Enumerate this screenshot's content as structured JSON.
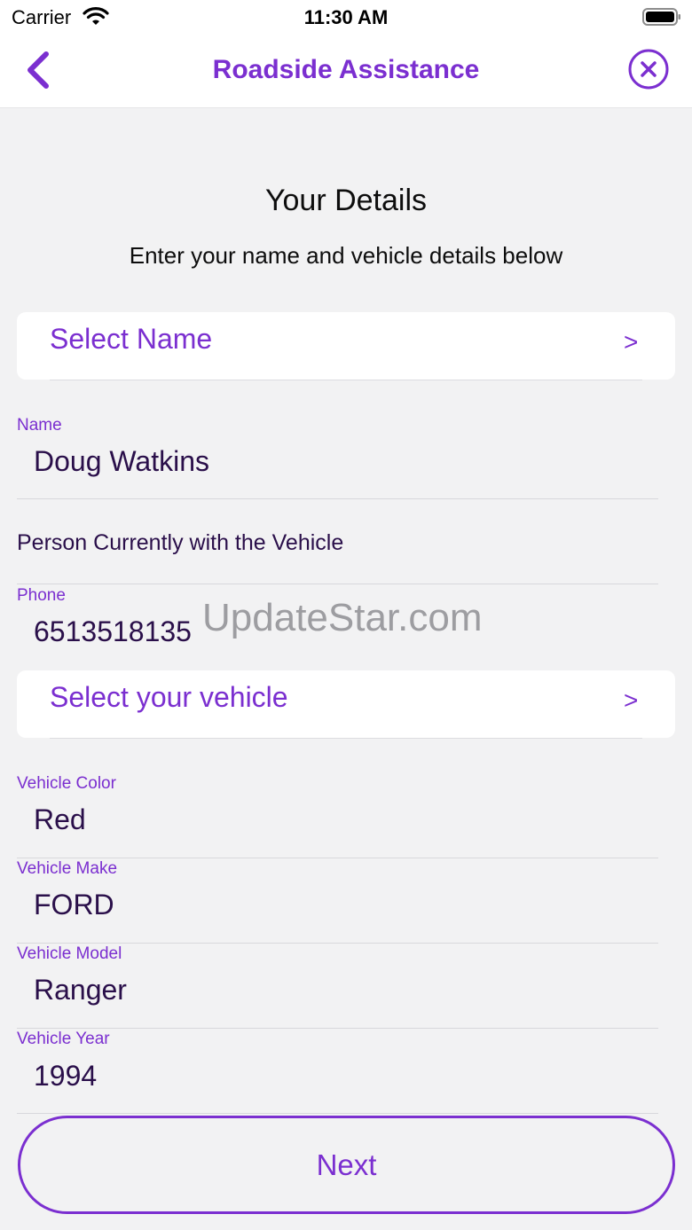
{
  "status_bar": {
    "carrier": "Carrier",
    "time": "11:30 AM"
  },
  "nav": {
    "title": "Roadside Assistance",
    "back_icon": "chevron-left-icon",
    "close_icon": "close-circle-icon"
  },
  "header": {
    "title": "Your Details",
    "subtitle": "Enter your name and vehicle details below"
  },
  "select_name": {
    "label": "Select Name",
    "chevron": ">"
  },
  "name_field": {
    "label": "Name",
    "value": "Doug Watkins"
  },
  "person_note": "Person Currently with the Vehicle",
  "phone_field": {
    "label": "Phone",
    "value": "6513518135"
  },
  "select_vehicle": {
    "label": "Select your vehicle",
    "chevron": ">"
  },
  "vehicle_color": {
    "label": "Vehicle Color",
    "value": "Red"
  },
  "vehicle_make": {
    "label": "Vehicle Make",
    "value": "FORD"
  },
  "vehicle_model": {
    "label": "Vehicle Model",
    "value": "Ranger"
  },
  "vehicle_year": {
    "label": "Vehicle Year",
    "value": "1994"
  },
  "watermark": "UpdateStar.com",
  "next_button": {
    "label": "Next"
  },
  "colors": {
    "accent": "#7b2fd0",
    "text_dark": "#2a0f4a",
    "background": "#f2f2f3"
  }
}
